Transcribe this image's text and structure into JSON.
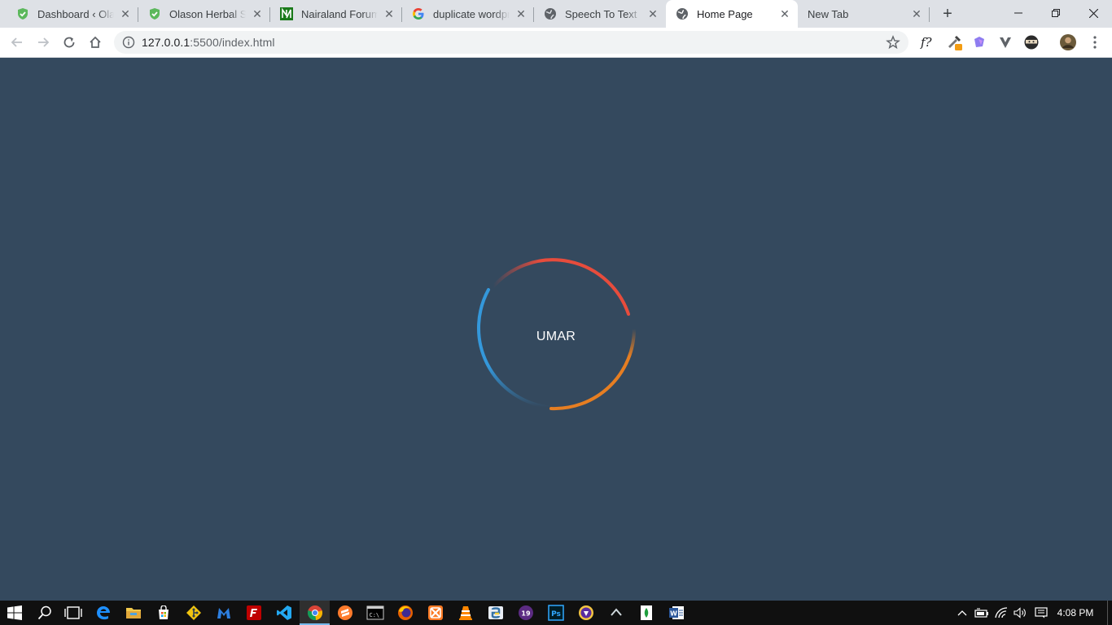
{
  "browser": {
    "tabs": [
      {
        "title": "Dashboard ‹ Olaso",
        "favicon": "shield-check-icon",
        "active": false
      },
      {
        "title": "Olason Herbal Sho",
        "favicon": "shield-check-icon",
        "active": false
      },
      {
        "title": "Nairaland Forum",
        "favicon": "nairaland-icon",
        "active": false
      },
      {
        "title": "duplicate wordpre",
        "favicon": "google-icon",
        "active": false
      },
      {
        "title": "Speech To Text",
        "favicon": "globe-icon",
        "active": false
      },
      {
        "title": "Home Page",
        "favicon": "globe-icon",
        "active": true
      },
      {
        "title": "New Tab",
        "favicon": "",
        "active": false
      }
    ],
    "close_glyph": "✕",
    "new_tab_glyph": "+",
    "window_controls": {
      "minimize": "—",
      "restore": "❐",
      "close": "✕"
    },
    "address": {
      "host": "127.0.0.1",
      "rest": ":5500/index.html"
    },
    "extensions": [
      "formula-icon",
      "eyedropper-icon",
      "puzzle-icon",
      "v-icon",
      "ninja-icon",
      "avatar"
    ]
  },
  "page": {
    "loader_text": "UMAR",
    "colors": {
      "background": "#34495e",
      "ring_top": "#e74c3c",
      "ring_right": "#e67e22",
      "ring_left": "#3498db"
    }
  },
  "taskbar": {
    "apps": [
      "start-icon",
      "search-icon",
      "task-view-icon",
      "edge-icon",
      "file-explorer-icon",
      "store-icon",
      "git-icon",
      "malwarebytes-icon",
      "filezilla-icon",
      "vscode-icon",
      "chrome-icon",
      "sublime-icon",
      "cmd-icon",
      "firefox-icon",
      "xampp-icon",
      "vlc-icon",
      "python-icon",
      "nineteen-icon",
      "photoshop-icon",
      "brave-icon",
      "arrow-icon",
      "green-doc-icon",
      "word-icon"
    ],
    "nineteen_label": "19",
    "photoshop_label": "Ps",
    "word_label": "W",
    "cmd_label": "C:\\",
    "clock": "4:08 PM"
  }
}
